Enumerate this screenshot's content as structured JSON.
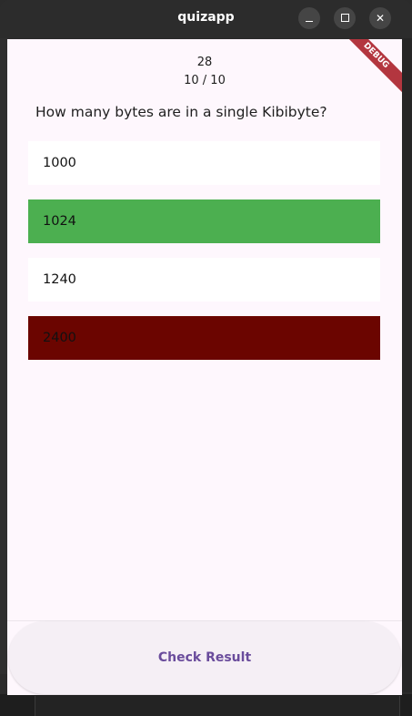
{
  "window": {
    "title": "quizapp",
    "controls": {
      "minimize": "minimize-icon",
      "maximize": "maximize-icon",
      "close": "close-icon"
    }
  },
  "debug_banner": "DEBUG",
  "quiz": {
    "counter": "28",
    "progress": "10 /  10",
    "question": "How many bytes are in a single Kibibyte?",
    "options": [
      {
        "label": "1000",
        "state": "neutral"
      },
      {
        "label": "1024",
        "state": "correct"
      },
      {
        "label": "1240",
        "state": "neutral"
      },
      {
        "label": "2400",
        "state": "wrong"
      }
    ],
    "check_button": "Check Result"
  },
  "colors": {
    "correct": "#4caf50",
    "wrong": "#6b0500",
    "background": "#fef7fd",
    "button_text": "#6a4c9c"
  }
}
